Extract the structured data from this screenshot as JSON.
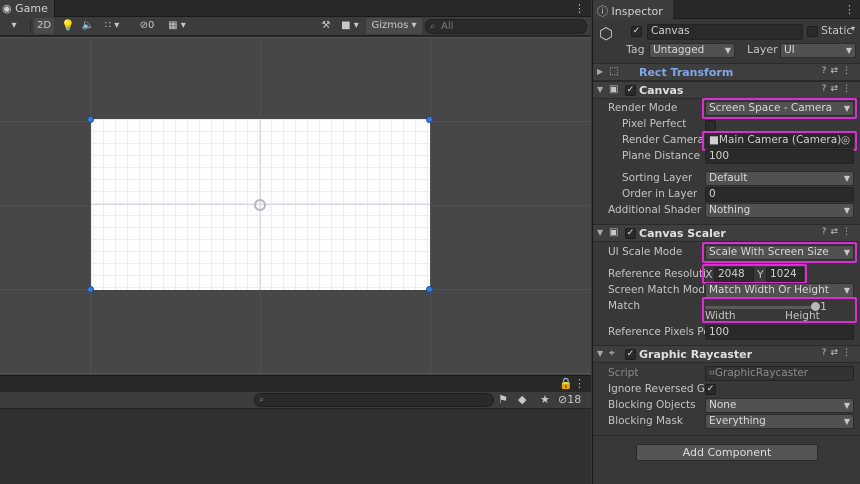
{
  "game": {
    "tab_label": "Game",
    "toolbar": {
      "mode_2d": "2D",
      "hidden_count": "0",
      "gizmos": "Gizmos",
      "search_placeholder": "All"
    }
  },
  "bottom": {
    "search_placeholder": "",
    "hidden_count": "18"
  },
  "inspector": {
    "tab_label": "Inspector",
    "object_name": "Canvas",
    "static_label": "Static",
    "tag_label": "Tag",
    "tag_value": "Untagged",
    "layer_label": "Layer",
    "layer_value": "UI",
    "rect_transform": {
      "title": "Rect Transform"
    },
    "canvas": {
      "title": "Canvas",
      "render_mode_label": "Render Mode",
      "render_mode_value": "Screen Space - Camera",
      "pixel_perfect_label": "Pixel Perfect",
      "render_camera_label": "Render Camera",
      "render_camera_value": "Main Camera (Camera)",
      "plane_distance_label": "Plane Distance",
      "plane_distance_value": "100",
      "sorting_layer_label": "Sorting Layer",
      "sorting_layer_value": "Default",
      "order_in_layer_label": "Order in Layer",
      "order_in_layer_value": "0",
      "shader_channels_label": "Additional Shader C",
      "shader_channels_value": "Nothing"
    },
    "canvas_scaler": {
      "title": "Canvas Scaler",
      "ui_scale_mode_label": "UI Scale Mode",
      "ui_scale_mode_value": "Scale With Screen Size",
      "ref_resolution_label": "Reference Resolutio",
      "ref_x_label": "X",
      "ref_x_value": "2048",
      "ref_y_label": "Y",
      "ref_y_value": "1024",
      "screen_match_label": "Screen Match Mode",
      "screen_match_value": "Match Width Or Height",
      "match_label": "Match",
      "match_value": "1",
      "match_fraction": 1,
      "match_left_label": "Width",
      "match_right_label": "Height",
      "ref_pixels_label": "Reference Pixels Per",
      "ref_pixels_value": "100"
    },
    "graphic_raycaster": {
      "title": "Graphic Raycaster",
      "script_label": "Script",
      "script_value": "GraphicRaycaster",
      "ignore_reversed_label": "Ignore Reversed Gra",
      "blocking_objects_label": "Blocking Objects",
      "blocking_objects_value": "None",
      "blocking_mask_label": "Blocking Mask",
      "blocking_mask_value": "Everything"
    },
    "add_component_label": "Add Component"
  },
  "colors": {
    "highlight": "#e02ad6",
    "handle": "#3a7bd5",
    "link_blue": "#7fa8e6"
  }
}
